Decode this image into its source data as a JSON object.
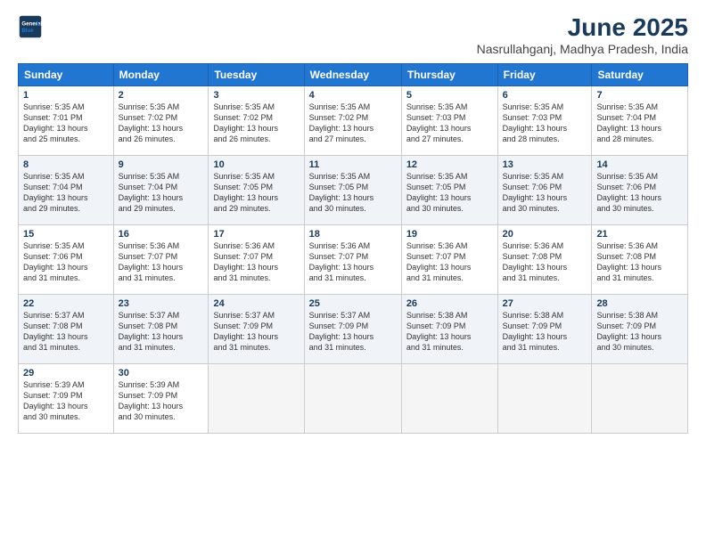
{
  "header": {
    "logo_line1": "General",
    "logo_line2": "Blue",
    "title": "June 2025",
    "subtitle": "Nasrullahganj, Madhya Pradesh, India"
  },
  "days_of_week": [
    "Sunday",
    "Monday",
    "Tuesday",
    "Wednesday",
    "Thursday",
    "Friday",
    "Saturday"
  ],
  "weeks": [
    [
      {
        "num": "1",
        "info": "Sunrise: 5:35 AM\nSunset: 7:01 PM\nDaylight: 13 hours\nand 25 minutes."
      },
      {
        "num": "2",
        "info": "Sunrise: 5:35 AM\nSunset: 7:02 PM\nDaylight: 13 hours\nand 26 minutes."
      },
      {
        "num": "3",
        "info": "Sunrise: 5:35 AM\nSunset: 7:02 PM\nDaylight: 13 hours\nand 26 minutes."
      },
      {
        "num": "4",
        "info": "Sunrise: 5:35 AM\nSunset: 7:02 PM\nDaylight: 13 hours\nand 27 minutes."
      },
      {
        "num": "5",
        "info": "Sunrise: 5:35 AM\nSunset: 7:03 PM\nDaylight: 13 hours\nand 27 minutes."
      },
      {
        "num": "6",
        "info": "Sunrise: 5:35 AM\nSunset: 7:03 PM\nDaylight: 13 hours\nand 28 minutes."
      },
      {
        "num": "7",
        "info": "Sunrise: 5:35 AM\nSunset: 7:04 PM\nDaylight: 13 hours\nand 28 minutes."
      }
    ],
    [
      {
        "num": "8",
        "info": "Sunrise: 5:35 AM\nSunset: 7:04 PM\nDaylight: 13 hours\nand 29 minutes."
      },
      {
        "num": "9",
        "info": "Sunrise: 5:35 AM\nSunset: 7:04 PM\nDaylight: 13 hours\nand 29 minutes."
      },
      {
        "num": "10",
        "info": "Sunrise: 5:35 AM\nSunset: 7:05 PM\nDaylight: 13 hours\nand 29 minutes."
      },
      {
        "num": "11",
        "info": "Sunrise: 5:35 AM\nSunset: 7:05 PM\nDaylight: 13 hours\nand 30 minutes."
      },
      {
        "num": "12",
        "info": "Sunrise: 5:35 AM\nSunset: 7:05 PM\nDaylight: 13 hours\nand 30 minutes."
      },
      {
        "num": "13",
        "info": "Sunrise: 5:35 AM\nSunset: 7:06 PM\nDaylight: 13 hours\nand 30 minutes."
      },
      {
        "num": "14",
        "info": "Sunrise: 5:35 AM\nSunset: 7:06 PM\nDaylight: 13 hours\nand 30 minutes."
      }
    ],
    [
      {
        "num": "15",
        "info": "Sunrise: 5:35 AM\nSunset: 7:06 PM\nDaylight: 13 hours\nand 31 minutes."
      },
      {
        "num": "16",
        "info": "Sunrise: 5:36 AM\nSunset: 7:07 PM\nDaylight: 13 hours\nand 31 minutes."
      },
      {
        "num": "17",
        "info": "Sunrise: 5:36 AM\nSunset: 7:07 PM\nDaylight: 13 hours\nand 31 minutes."
      },
      {
        "num": "18",
        "info": "Sunrise: 5:36 AM\nSunset: 7:07 PM\nDaylight: 13 hours\nand 31 minutes."
      },
      {
        "num": "19",
        "info": "Sunrise: 5:36 AM\nSunset: 7:07 PM\nDaylight: 13 hours\nand 31 minutes."
      },
      {
        "num": "20",
        "info": "Sunrise: 5:36 AM\nSunset: 7:08 PM\nDaylight: 13 hours\nand 31 minutes."
      },
      {
        "num": "21",
        "info": "Sunrise: 5:36 AM\nSunset: 7:08 PM\nDaylight: 13 hours\nand 31 minutes."
      }
    ],
    [
      {
        "num": "22",
        "info": "Sunrise: 5:37 AM\nSunset: 7:08 PM\nDaylight: 13 hours\nand 31 minutes."
      },
      {
        "num": "23",
        "info": "Sunrise: 5:37 AM\nSunset: 7:08 PM\nDaylight: 13 hours\nand 31 minutes."
      },
      {
        "num": "24",
        "info": "Sunrise: 5:37 AM\nSunset: 7:09 PM\nDaylight: 13 hours\nand 31 minutes."
      },
      {
        "num": "25",
        "info": "Sunrise: 5:37 AM\nSunset: 7:09 PM\nDaylight: 13 hours\nand 31 minutes."
      },
      {
        "num": "26",
        "info": "Sunrise: 5:38 AM\nSunset: 7:09 PM\nDaylight: 13 hours\nand 31 minutes."
      },
      {
        "num": "27",
        "info": "Sunrise: 5:38 AM\nSunset: 7:09 PM\nDaylight: 13 hours\nand 31 minutes."
      },
      {
        "num": "28",
        "info": "Sunrise: 5:38 AM\nSunset: 7:09 PM\nDaylight: 13 hours\nand 30 minutes."
      }
    ],
    [
      {
        "num": "29",
        "info": "Sunrise: 5:39 AM\nSunset: 7:09 PM\nDaylight: 13 hours\nand 30 minutes."
      },
      {
        "num": "30",
        "info": "Sunrise: 5:39 AM\nSunset: 7:09 PM\nDaylight: 13 hours\nand 30 minutes."
      },
      {
        "num": "",
        "info": ""
      },
      {
        "num": "",
        "info": ""
      },
      {
        "num": "",
        "info": ""
      },
      {
        "num": "",
        "info": ""
      },
      {
        "num": "",
        "info": ""
      }
    ]
  ]
}
